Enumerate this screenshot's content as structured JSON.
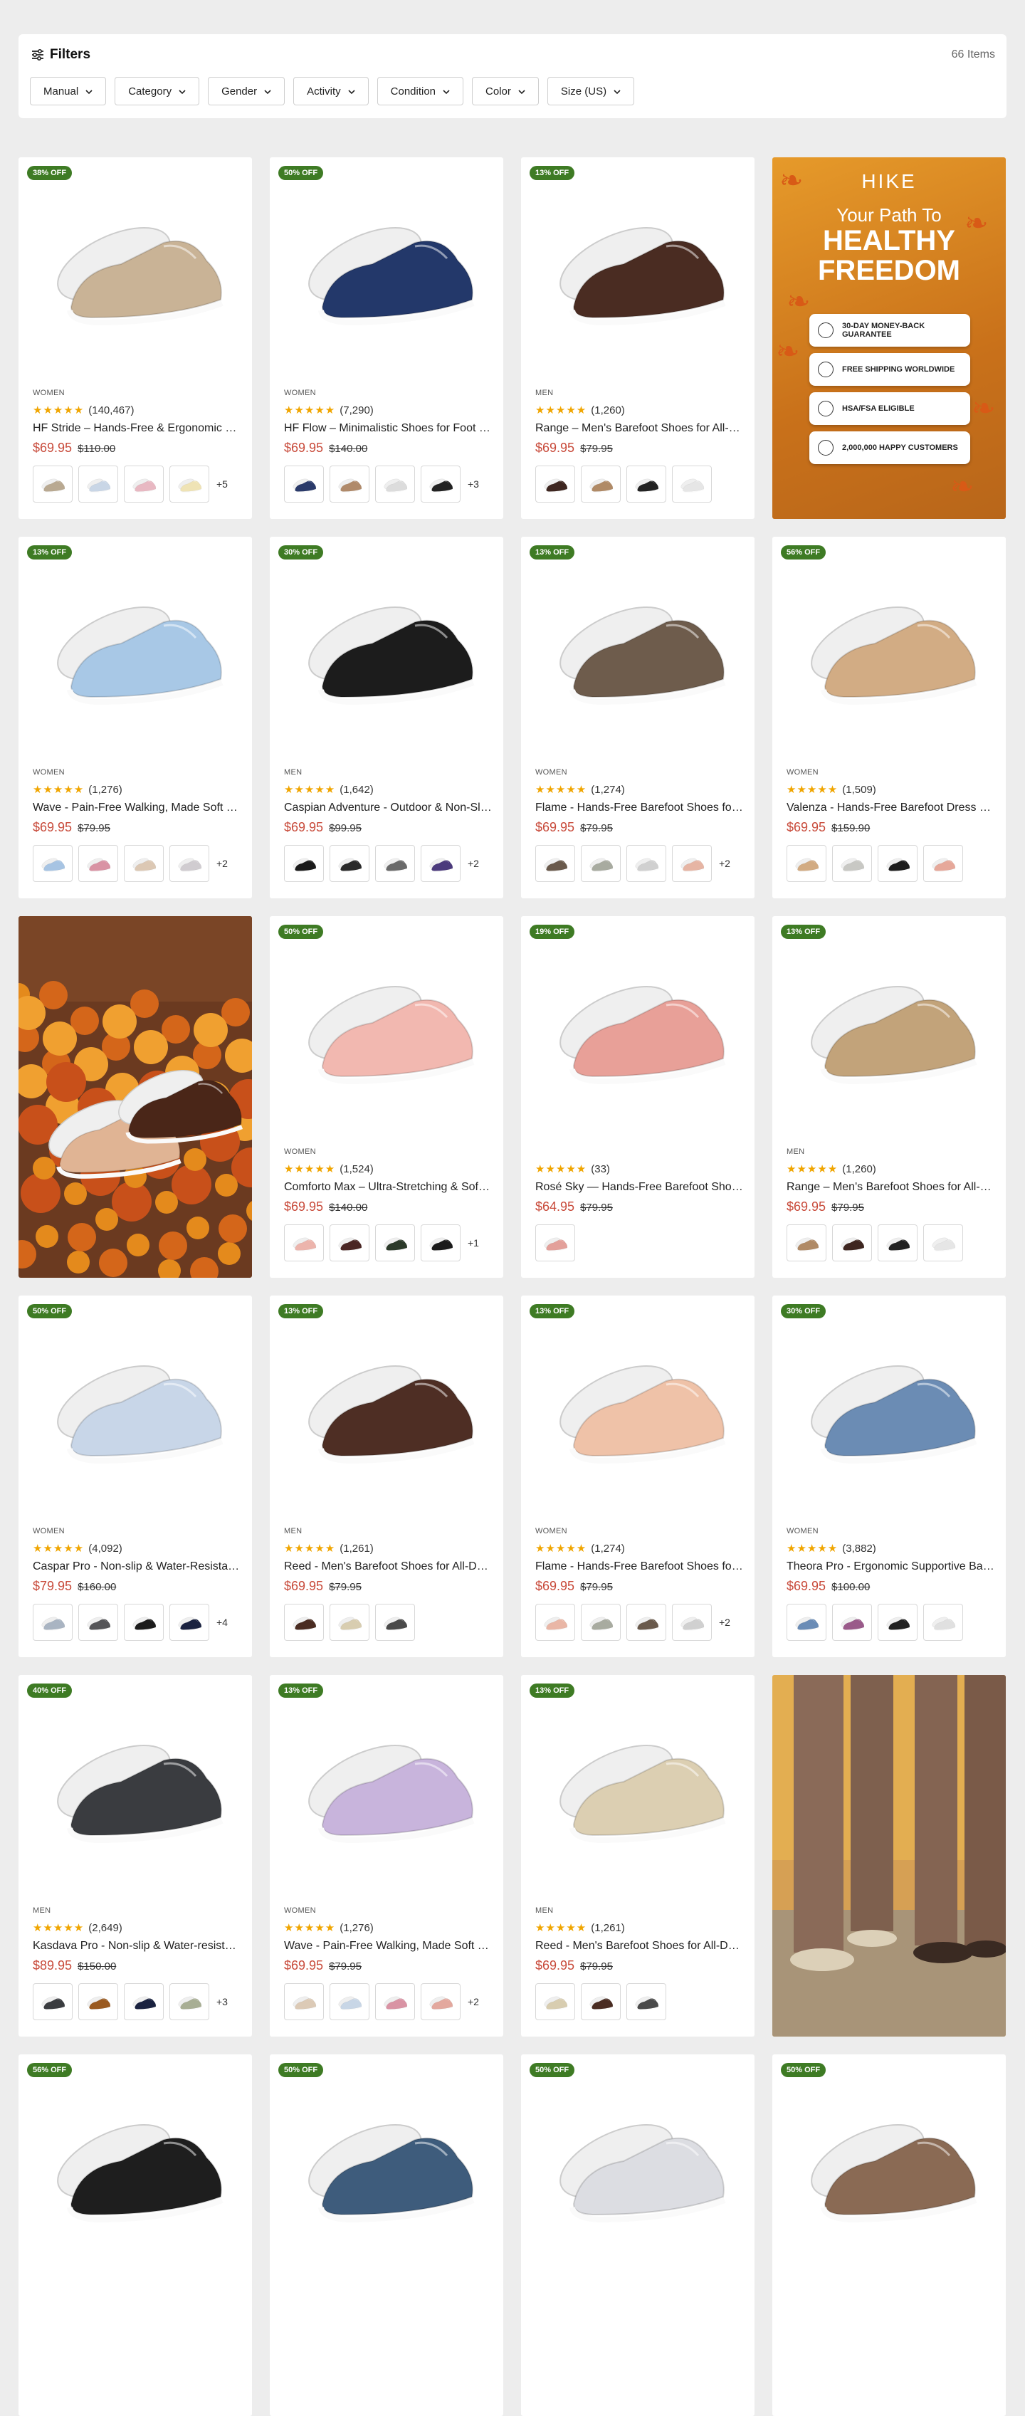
{
  "filters": {
    "title": "Filters",
    "count": "66 Items",
    "buttons": [
      "Manual",
      "Category",
      "Gender",
      "Activity",
      "Condition",
      "Color",
      "Size (US)"
    ]
  },
  "promo": {
    "brand": "HIKE",
    "tagline1": "Your Path To",
    "tagline2": "HEALTHY FREEDOM",
    "features": [
      "30-DAY MONEY-BACK GUARANTEE",
      "FREE SHIPPING WORLDWIDE",
      "HSA/FSA ELIGIBLE",
      "2,000,000 HAPPY CUSTOMERS"
    ]
  },
  "products": [
    {
      "badge": "38% OFF",
      "gender": "WOMEN",
      "reviews": "(140,467)",
      "title": "HF Stride – Hands-Free & Ergonomic Barefoot Shoes",
      "price": "$69.95",
      "old_price": "$110.00",
      "more": "+5",
      "color": "#c9b396",
      "swatches": [
        "#b9a991",
        "#c9d6e6",
        "#e8b8c2",
        "#efe3b5"
      ]
    },
    {
      "badge": "50% OFF",
      "gender": "WOMEN",
      "reviews": "(7,290)",
      "title": "HF Flow – Minimalistic Shoes for Foot Health",
      "price": "$69.95",
      "old_price": "$140.00",
      "more": "+3",
      "color": "#23386a",
      "swatches": [
        "#2a3a6a",
        "#b08a6a",
        "#dcdcdc",
        "#222222"
      ]
    },
    {
      "badge": "13% OFF",
      "gender": "MEN",
      "reviews": "(1,260)",
      "title": "Range – Men's Barefoot Shoes for All-Day Comfort",
      "price": "$69.95",
      "old_price": "$79.95",
      "more": "",
      "color": "#4a2c22",
      "swatches": [
        "#3e2620",
        "#b08a66",
        "#222222",
        "#e6e6e6"
      ]
    },
    {
      "promo": true
    },
    {
      "badge": "13% OFF",
      "gender": "WOMEN",
      "reviews": "(1,276)",
      "title": "Wave - Pain-Free Walking, Made Soft & Simple",
      "price": "$69.95",
      "old_price": "$79.95",
      "more": "+2",
      "color": "#a8c8e6",
      "swatches": [
        "#a7c4e3",
        "#d993a4",
        "#dcc8b4",
        "#d0ccd0"
      ]
    },
    {
      "badge": "30% OFF",
      "gender": "MEN",
      "reviews": "(1,642)",
      "title": "Caspian Adventure - Outdoor & Non-Slip Barefoot Shoes",
      "price": "$69.95",
      "old_price": "$99.95",
      "more": "+2",
      "color": "#1c1c1c",
      "swatches": [
        "#1a1a1a",
        "#2a2a2a",
        "#6a6a6a",
        "#4b3a7c"
      ]
    },
    {
      "badge": "13% OFF",
      "gender": "WOMEN",
      "reviews": "(1,274)",
      "title": "Flame - Hands-Free Barefoot Shoes for Women",
      "price": "$69.95",
      "old_price": "$79.95",
      "more": "+2",
      "color": "#6e5c4c",
      "swatches": [
        "#6a5a4c",
        "#a8aba0",
        "#d0d0d0",
        "#e6b5a4"
      ]
    },
    {
      "badge": "56% OFF",
      "gender": "WOMEN",
      "reviews": "(1,509)",
      "title": "Valenza - Hands-Free Barefoot Dress Shoes",
      "price": "$69.95",
      "old_price": "$159.90",
      "more": "",
      "color": "#d2ac84",
      "swatches": [
        "#d2ab82",
        "#c8c8c4",
        "#1e1e1e",
        "#e6a89a"
      ]
    },
    {
      "photo": "leaves"
    },
    {
      "badge": "50% OFF",
      "gender": "WOMEN",
      "reviews": "(1,524)",
      "title": "Comforto Max – Ultra-Stretching & Soft Barefoot Shoes",
      "price": "$69.95",
      "old_price": "$140.00",
      "more": "+1",
      "color": "#f2b8b0",
      "swatches": [
        "#ecb4ac",
        "#4a2624",
        "#2c3a2a",
        "#1a1a1a"
      ]
    },
    {
      "badge": "19% OFF",
      "gender": "",
      "reviews": "(33)",
      "title": "Rosé Sky — Hands-Free Barefoot Shoes",
      "price": "$64.95",
      "old_price": "$79.95",
      "more": "",
      "color": "#e8a098",
      "swatches": [
        "#e3a09a"
      ]
    },
    {
      "badge": "13% OFF",
      "gender": "MEN",
      "reviews": "(1,260)",
      "title": "Range – Men's Barefoot Shoes for All-Day Comfort",
      "price": "$69.95",
      "old_price": "$79.95",
      "more": "",
      "color": "#c2a37a",
      "swatches": [
        "#b08a66",
        "#3e2620",
        "#222222",
        "#e6e6e6"
      ]
    },
    {
      "badge": "50% OFF",
      "gender": "WOMEN",
      "reviews": "(4,092)",
      "title": "Caspar Pro - Non-slip & Water-Resistant Barefoot Boots",
      "price": "$79.95",
      "old_price": "$160.00",
      "more": "+4",
      "color": "#c8d6e8",
      "swatches": [
        "#a9b4c2",
        "#555558",
        "#1c1c1c",
        "#1a2240"
      ]
    },
    {
      "badge": "13% OFF",
      "gender": "MEN",
      "reviews": "(1,261)",
      "title": "Reed - Men's Barefoot Shoes for All-Day Wear",
      "price": "$69.95",
      "old_price": "$79.95",
      "more": "",
      "color": "#4e2e24",
      "swatches": [
        "#4a2c22",
        "#d8cdb0",
        "#4a4a4a"
      ]
    },
    {
      "badge": "13% OFF",
      "gender": "WOMEN",
      "reviews": "(1,274)",
      "title": "Flame - Hands-Free Barefoot Shoes for Women",
      "price": "$69.95",
      "old_price": "$79.95",
      "more": "+2",
      "color": "#efc2a8",
      "swatches": [
        "#e9b6a6",
        "#a8aba0",
        "#6a5a4c",
        "#d0d0d0"
      ]
    },
    {
      "badge": "30% OFF",
      "gender": "WOMEN",
      "reviews": "(3,882)",
      "title": "Theora Pro - Ergonomic Supportive Barefoot Shoes",
      "price": "$69.95",
      "old_price": "$100.00",
      "more": "",
      "color": "#6b8cb4",
      "swatches": [
        "#6a8cb6",
        "#9a5a8a",
        "#222222",
        "#e0e0e0"
      ]
    },
    {
      "badge": "40% OFF",
      "gender": "MEN",
      "reviews": "(2,649)",
      "title": "Kasdava Pro - Non-slip & Water-resistant Barefoot Boots",
      "price": "$89.95",
      "old_price": "$150.00",
      "more": "+3",
      "color": "#3a3c40",
      "swatches": [
        "#3a3c40",
        "#9a5a20",
        "#1a2240",
        "#a8ae94"
      ]
    },
    {
      "badge": "13% OFF",
      "gender": "WOMEN",
      "reviews": "(1,276)",
      "title": "Wave - Pain-Free Walking, Made Soft & Simple",
      "price": "$69.95",
      "old_price": "$79.95",
      "more": "+2",
      "color": "#c8b4dc",
      "swatches": [
        "#dccab6",
        "#c8d6e6",
        "#d993a4",
        "#e3a89e"
      ]
    },
    {
      "badge": "13% OFF",
      "gender": "MEN",
      "reviews": "(1,261)",
      "title": "Reed - Men's Barefoot Shoes for All-Day Wear",
      "price": "$69.95",
      "old_price": "$79.95",
      "more": "",
      "color": "#dccfb2",
      "swatches": [
        "#d8cdb0",
        "#4a2c22",
        "#4a4a4a"
      ]
    },
    {
      "photo": "legs"
    },
    {
      "badge": "56% OFF",
      "color": "#1e1e1e",
      "partial": true
    },
    {
      "badge": "50% OFF",
      "color": "#3e5c7c",
      "partial": true
    },
    {
      "badge": "50% OFF",
      "color": "#dcdde2",
      "partial": true
    },
    {
      "badge": "50% OFF",
      "color": "#8a6a54",
      "partial": true
    }
  ]
}
